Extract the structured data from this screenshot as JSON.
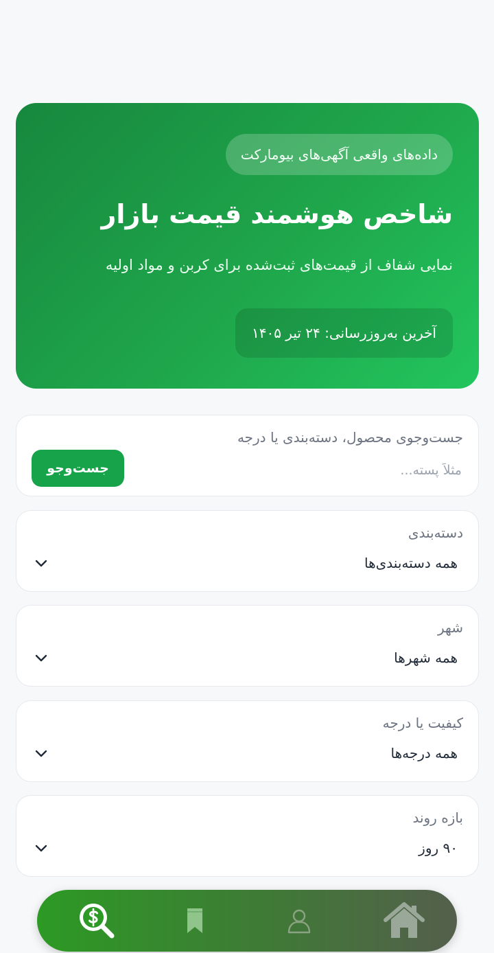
{
  "hero": {
    "badge": "داده‌های واقعی آگهی‌های بیومارکت",
    "title": "شاخص هوشمند قیمت بازار",
    "subtitle": "نمایی شفاف از قیمت‌های ثبت‌شده برای کربن و مواد اولیه",
    "updated": "آخرین به‌روزرسانی: ۲۴ تیر ۱۴۰۵"
  },
  "search": {
    "label": "جست‌وجوی محصول، دسته‌بندی یا درجه",
    "placeholder": "مثلاً پسته...",
    "value": "",
    "button_label": "جست‌وجو"
  },
  "filters": {
    "category": {
      "label": "دسته‌بندی",
      "value": "همه دسته‌بندی‌ها"
    },
    "city": {
      "label": "شهر",
      "value": "همه شهرها"
    },
    "grade": {
      "label": "کیفیت یا درجه",
      "value": "همه درجه‌ها"
    },
    "range": {
      "label": "بازه روند",
      "value": "۹۰ روز"
    }
  },
  "bottom_nav": {
    "items": [
      {
        "icon": "price-search-icon",
        "active": true
      },
      {
        "icon": "bookmark-icon",
        "active": false
      },
      {
        "icon": "user-icon",
        "active": false
      },
      {
        "icon": "home-icon",
        "active": false
      }
    ]
  },
  "colors": {
    "primary": "#16a34a",
    "hero_start": "#17883e",
    "hero_end": "#22c55e",
    "page_bg": "#f7f8fa"
  }
}
